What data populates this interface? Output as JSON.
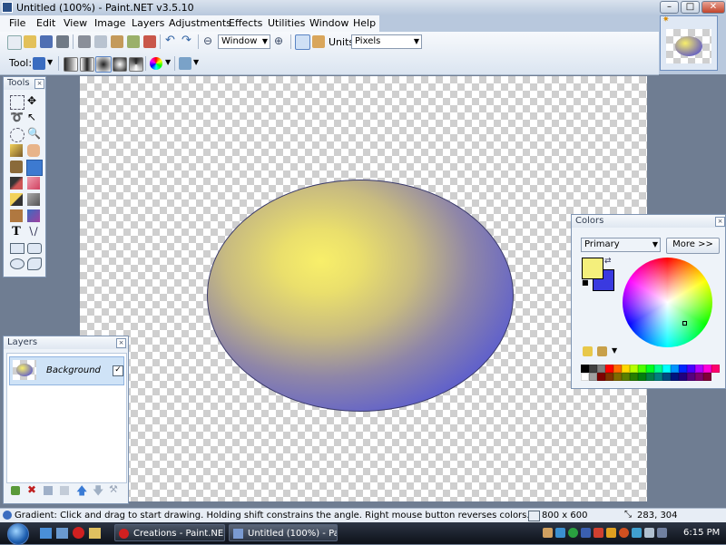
{
  "window": {
    "title": "Untitled (100%) - Paint.NET v3.5.10"
  },
  "menu": [
    "File",
    "Edit",
    "View",
    "Image",
    "Layers",
    "Adjustments",
    "Effects",
    "Utilities",
    "Window",
    "Help"
  ],
  "toolbar": {
    "zoom_mode": "Window",
    "units_label": "Units:",
    "units_value": "Pixels",
    "tool_label": "Tool:"
  },
  "tools_panel": {
    "title": "Tools"
  },
  "layers_panel": {
    "title": "Layers",
    "layers": [
      {
        "name": "Background",
        "visible": true
      }
    ]
  },
  "colors_panel": {
    "title": "Colors",
    "mode": "Primary",
    "more_button": "More >>",
    "primary_color": "#f4ef7c",
    "secondary_color": "#3a3ae0"
  },
  "canvas": {
    "gradient_start": "#f8ef6a",
    "gradient_end": "#3a3ae0"
  },
  "status": {
    "hint": "Gradient: Click and drag to start drawing. Holding shift constrains the angle. Right mouse button reverses colors.",
    "image_size": "800 x 600",
    "cursor_position": "283, 304"
  },
  "taskbar": {
    "tasks": [
      "Creations - Paint.NE...",
      "Untitled (100%) - Pa..."
    ],
    "clock": "6:15 PM"
  },
  "palette": [
    "#000000",
    "#404040",
    "#7f7f7f",
    "#ff0000",
    "#ff6a00",
    "#ffd800",
    "#b6ff00",
    "#4cff00",
    "#00ff21",
    "#00ff90",
    "#00ffff",
    "#0094ff",
    "#0026ff",
    "#4800ff",
    "#b200ff",
    "#ff00dc",
    "#ff006e",
    "#ffffff",
    "#a0a0a0",
    "#7f0000",
    "#7f3300",
    "#7f6a00",
    "#5b7f00",
    "#267f00",
    "#007f0e",
    "#007f46",
    "#007f7f",
    "#004a7f",
    "#00137f",
    "#21007f",
    "#57007f",
    "#7f006e",
    "#7f0037"
  ]
}
